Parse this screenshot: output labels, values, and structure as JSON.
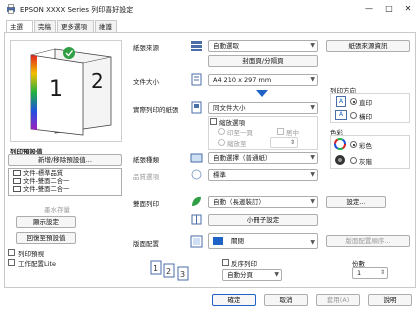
{
  "window": {
    "title": "EPSON XXXX Series 列印喜好設定",
    "minimize": "—",
    "maximize": "□",
    "close": "✕"
  },
  "tabs": [
    {
      "label": "主選單"
    },
    {
      "label": "完稿"
    },
    {
      "label": "更多選項"
    },
    {
      "label": "維護"
    }
  ],
  "preview": {
    "page_front": "1",
    "page_back": "2"
  },
  "presets": {
    "header": "列印預設值",
    "add_remove_btn": "新增/移除預設值...",
    "items": [
      "文件-標準品質",
      "文件-雙面二合一",
      "文件-雙面二合一"
    ]
  },
  "left_buttons": {
    "ink_levels": "墨水存量",
    "show_settings": "顯示設定",
    "restore_defaults": "回復至預設值"
  },
  "left_checks": {
    "print_preview": "列印預視",
    "job_arranger": "工作配置Lite"
  },
  "paper_source": {
    "label": "紙張來源",
    "value": "自動選取",
    "info_btn": "紙張來源資訊",
    "cover_btn": "封面頁/分隔頁"
  },
  "doc_size": {
    "label": "文件大小",
    "value": "A4 210 x 297 mm"
  },
  "output_paper": {
    "label": "實際列印的紙張",
    "value": "同文件大小",
    "reduce_enlarge": "縮放選項",
    "fit_to_page": "印至一頁",
    "center": "居中",
    "zoom_to": "縮放至"
  },
  "orientation": {
    "label": "列印方向",
    "portrait": "直印",
    "landscape": "橫印"
  },
  "paper_type": {
    "label": "紙張種類",
    "value": "自動選擇（普通紙）"
  },
  "quality": {
    "label": "品質選項",
    "value": "標準"
  },
  "color": {
    "label": "色彩",
    "color_opt": "彩色",
    "grayscale_opt": "灰階"
  },
  "duplex": {
    "label": "雙面列印",
    "value": "自動（長邊裝訂）",
    "settings_btn": "設定...",
    "booklet_btn": "小冊子設定"
  },
  "layout": {
    "label": "版面配置",
    "value": "關閉",
    "order_btn": "版面配置順序..."
  },
  "reverse": {
    "label": "反序列印",
    "value": "自動分頁"
  },
  "copies": {
    "label": "份數",
    "value": "1"
  },
  "footer": {
    "ok": "確定",
    "cancel": "取消",
    "apply": "套用(A)",
    "help": "說明"
  },
  "colors": {
    "accent": "#1f63c6",
    "border": "#adadad",
    "disabled_text": "#9a9a9a"
  }
}
